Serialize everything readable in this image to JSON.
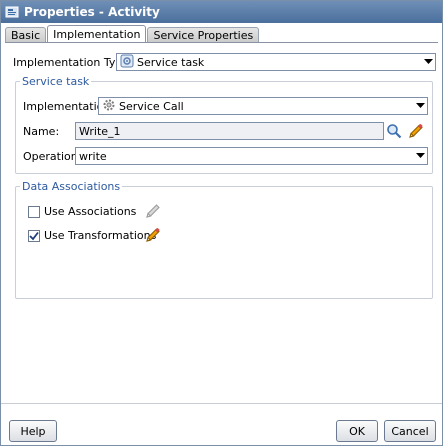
{
  "window": {
    "title": "Properties - Activity"
  },
  "tabs": [
    {
      "label": "Basic"
    },
    {
      "label": "Implementation"
    },
    {
      "label": "Service Properties"
    }
  ],
  "implementation_type": {
    "label": "Implementation Type:",
    "value": "Service task"
  },
  "service_task": {
    "title": "Service task",
    "implementation": {
      "label": "Implementation:",
      "value": "Service Call"
    },
    "name": {
      "label": "Name:",
      "value": "Write_1"
    },
    "operation": {
      "label": "Operation:",
      "value": "write"
    }
  },
  "data_associations": {
    "title": "Data Associations",
    "use_associations": {
      "label": "Use Associations",
      "checked": false
    },
    "use_transformations": {
      "label": "Use Transformations",
      "checked": true
    }
  },
  "footer": {
    "help": "Help",
    "ok": "OK",
    "cancel": "Cancel"
  },
  "colors": {
    "titlebar": "#4a6f9c",
    "group_title": "#2d5aa0"
  }
}
